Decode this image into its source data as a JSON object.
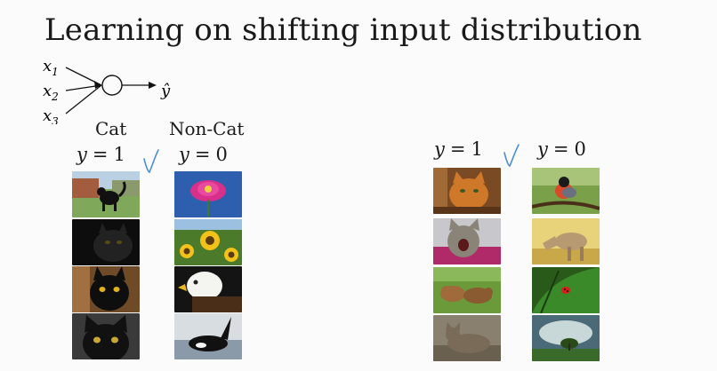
{
  "title": "Learning on shifting input distribution",
  "diagram": {
    "inputs": [
      "x1",
      "x2",
      "x3"
    ],
    "output": "ŷ"
  },
  "left_set": {
    "cat_header": "Cat",
    "noncat_header": "Non-Cat",
    "cat_label": {
      "var": "y",
      "op": "=",
      "val": "1"
    },
    "noncat_label": {
      "var": "y",
      "op": "=",
      "val": "0"
    },
    "cat_images": [
      "cat-on-grass",
      "black-cat-dark",
      "black-cat-yellow-eyes",
      "black-kitten-closeup"
    ],
    "noncat_images": [
      "pink-flower",
      "sunflowers",
      "bald-eagle",
      "orca-whale"
    ]
  },
  "right_set": {
    "cat_label": {
      "var": "y",
      "op": "=",
      "val": "1"
    },
    "noncat_label": {
      "var": "y",
      "op": "=",
      "val": "0"
    },
    "cat_images": [
      "orange-tabby-cat",
      "yawning-cat",
      "kittens-in-grass",
      "tabby-cat-lying"
    ],
    "noncat_images": [
      "bullfinch-bird",
      "horse",
      "ladybug-leaf",
      "tree-landscape"
    ]
  },
  "colors": {
    "check_mark": "#4a8fd6",
    "text": "#1a1a1a"
  }
}
